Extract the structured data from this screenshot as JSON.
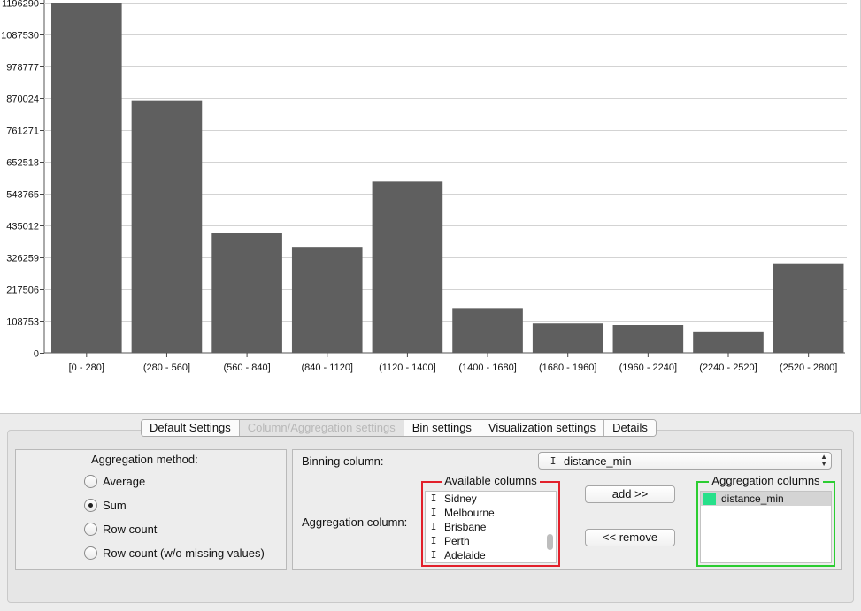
{
  "chart_data": {
    "type": "bar",
    "categories": [
      "[0 - 280]",
      "(280 - 560]",
      "(560 - 840]",
      "(840 - 1120]",
      "(1120 - 1400]",
      "(1400 - 1680]",
      "(1680 - 1960]",
      "(1960 - 2240]",
      "(2240 - 2520]",
      "(2520 - 2800]"
    ],
    "values": [
      1196290,
      862000,
      410000,
      362000,
      585000,
      153000,
      102000,
      94000,
      73000,
      303000
    ],
    "yticks": [
      "0",
      "108753",
      "217506",
      "326259",
      "435012",
      "543765",
      "652518",
      "761271",
      "870024",
      "978777",
      "1087530",
      "1196290"
    ],
    "ylim": [
      0,
      1196290
    ],
    "bar_color": "#5f5f5f",
    "grid": true
  },
  "tabs": [
    {
      "label": "Default Settings",
      "active": false
    },
    {
      "label": "Column/Aggregation settings",
      "active": true
    },
    {
      "label": "Bin settings",
      "active": false
    },
    {
      "label": "Visualization settings",
      "active": false
    },
    {
      "label": "Details",
      "active": false
    }
  ],
  "aggregation": {
    "title": "Aggregation method:",
    "options": [
      {
        "label": "Average",
        "checked": false
      },
      {
        "label": "Sum",
        "checked": true
      },
      {
        "label": "Row count",
        "checked": false
      },
      {
        "label": "Row count (w/o missing values)",
        "checked": false
      }
    ]
  },
  "columns": {
    "binning_label": "Binning column:",
    "binning_value": "distance_min",
    "aggregation_label": "Aggregation column:",
    "type_glyph": "I",
    "available_title": "Available columns",
    "available_items": [
      "Sidney",
      "Melbourne",
      "Brisbane",
      "Perth",
      "Adelaide"
    ],
    "aggregation_title": "Aggregation columns",
    "aggregation_items": [
      "distance_min"
    ],
    "aggregation_swatch": "#26e08a",
    "add_label": "add >>",
    "remove_label": "<< remove"
  }
}
